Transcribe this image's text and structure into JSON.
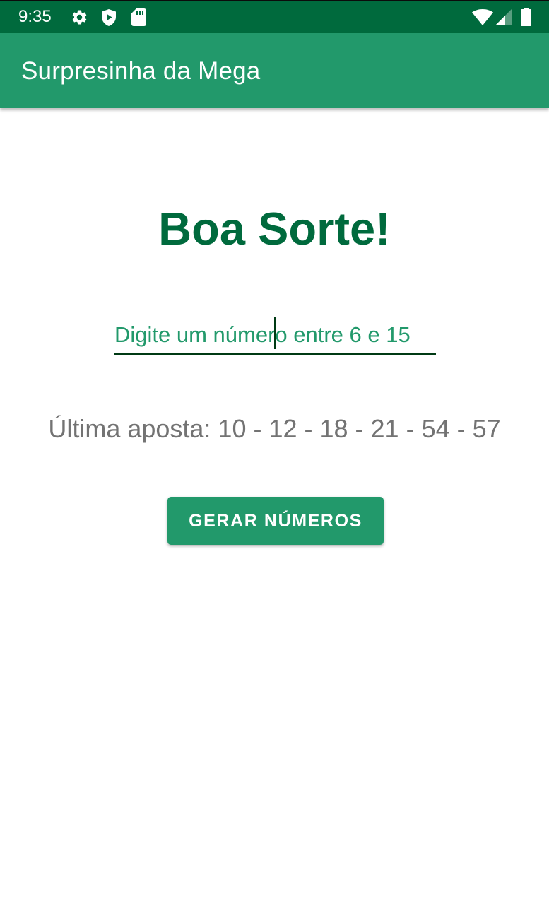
{
  "status_bar": {
    "time": "9:35",
    "left_icons": [
      "gear-icon",
      "shield-play-icon",
      "sd-card-icon"
    ],
    "right_icons": [
      "wifi-icon",
      "cell-signal-icon",
      "battery-icon"
    ]
  },
  "app_bar": {
    "title": "Surpresinha da Mega"
  },
  "main": {
    "headline": "Boa Sorte!",
    "number_input": {
      "value": "",
      "placeholder": "Digite um número entre 6 e 15"
    },
    "last_bet": "Última aposta: 10 - 12 - 18 - 21 - 54 - 57",
    "generate_button_label": "GERAR NÚMEROS"
  },
  "colors": {
    "status_bar": "#006a3d",
    "app_bar": "#22996b",
    "headline": "#006a3d",
    "input_text": "#22996b",
    "input_underline": "#003a14",
    "last_bet_text": "#737373",
    "button_background": "#22996b",
    "button_text": "#ffffff"
  }
}
